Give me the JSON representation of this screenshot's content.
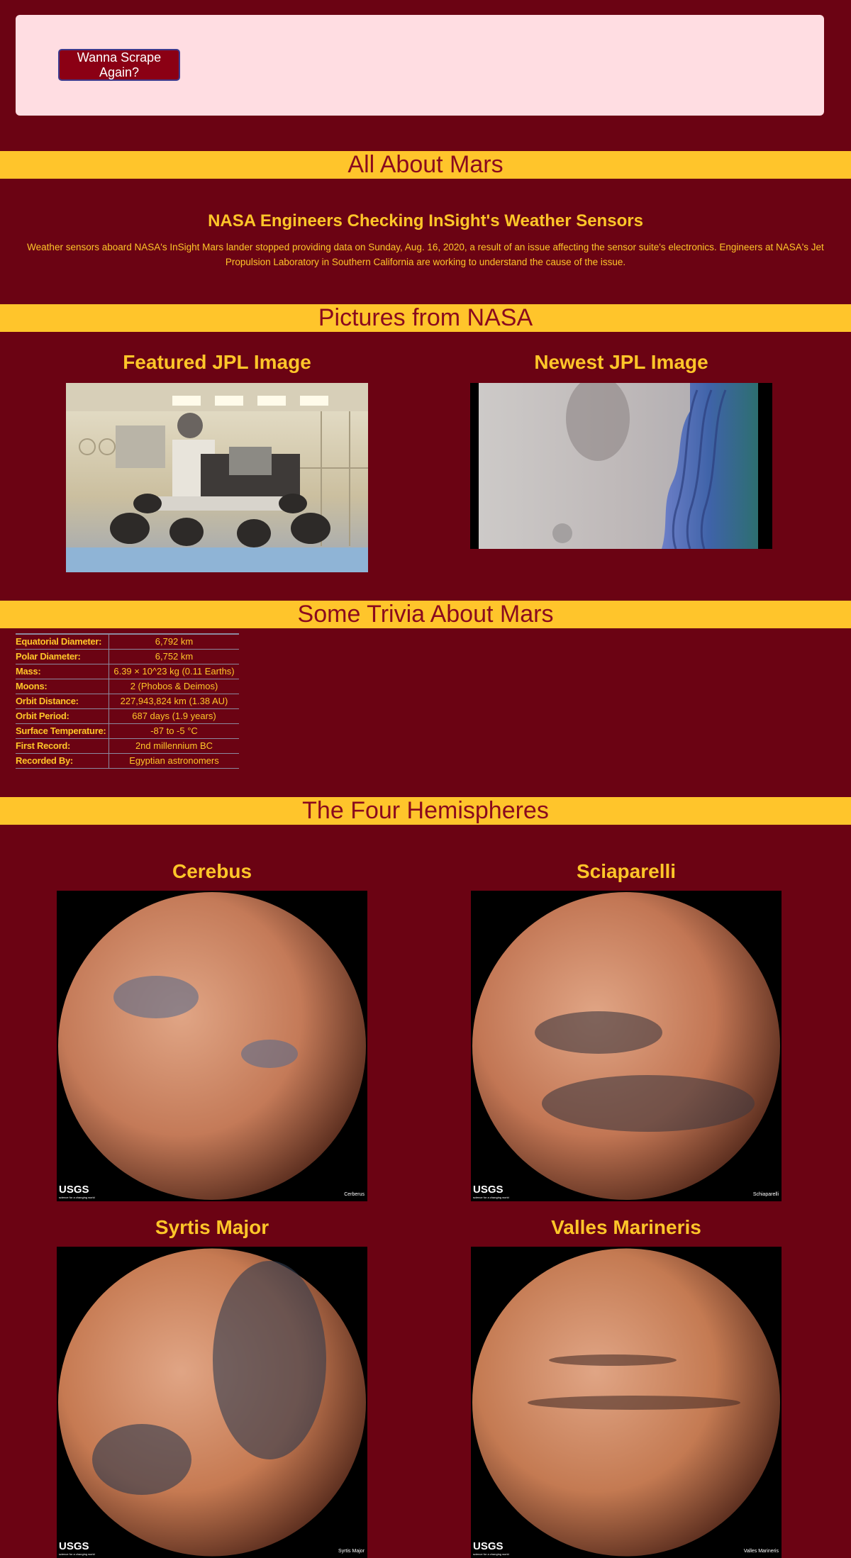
{
  "jumbotron": {
    "button_label": "Wanna Scrape Again?"
  },
  "sections": {
    "mars": "All About Mars",
    "pictures": "Pictures from NASA",
    "trivia": "Some Trivia About Mars",
    "hemispheres": "The Four Hemispheres"
  },
  "news": {
    "title": "NASA Engineers Checking InSight's Weather Sensors",
    "paragraph": "Weather sensors aboard NASA's InSight Mars lander stopped providing data on Sunday, Aug. 16, 2020, a result of an issue affecting the sensor suite's electronics. Engineers at NASA's Jet Propulsion Laboratory in Southern California are working to understand the cause of the issue."
  },
  "images": {
    "featured_title": "Featured JPL Image",
    "newest_title": "Newest JPL Image"
  },
  "facts": [
    {
      "label": "Equatorial Diameter:",
      "value": "6,792 km"
    },
    {
      "label": "Polar Diameter:",
      "value": "6,752 km"
    },
    {
      "label": "Mass:",
      "value": "6.39 × 10^23 kg (0.11 Earths)"
    },
    {
      "label": "Moons:",
      "value": "2 (Phobos & Deimos)"
    },
    {
      "label": "Orbit Distance:",
      "value": "227,943,824 km (1.38 AU)"
    },
    {
      "label": "Orbit Period:",
      "value": "687 days (1.9 years)"
    },
    {
      "label": "Surface Temperature:",
      "value": "-87 to -5 °C"
    },
    {
      "label": "First Record:",
      "value": "2nd millennium BC"
    },
    {
      "label": "Recorded By:",
      "value": "Egyptian astronomers"
    }
  ],
  "hemispheres": [
    {
      "title": "Cerebus",
      "caption": "Cerberus"
    },
    {
      "title": "Sciaparelli",
      "caption": "Schiaparelli"
    },
    {
      "title": "Syrtis Major",
      "caption": "Syrtis Major"
    },
    {
      "title": "Valles Marineris",
      "caption": "Valles Marineris"
    }
  ],
  "usgs_logo": "USGS",
  "usgs_tagline": "science for a changing world",
  "colors": {
    "background": "#6b0313",
    "banner": "#ffc52b",
    "text": "#ffc629",
    "banner_text": "#8a0a1e",
    "jumbotron": "#ffdde2"
  }
}
